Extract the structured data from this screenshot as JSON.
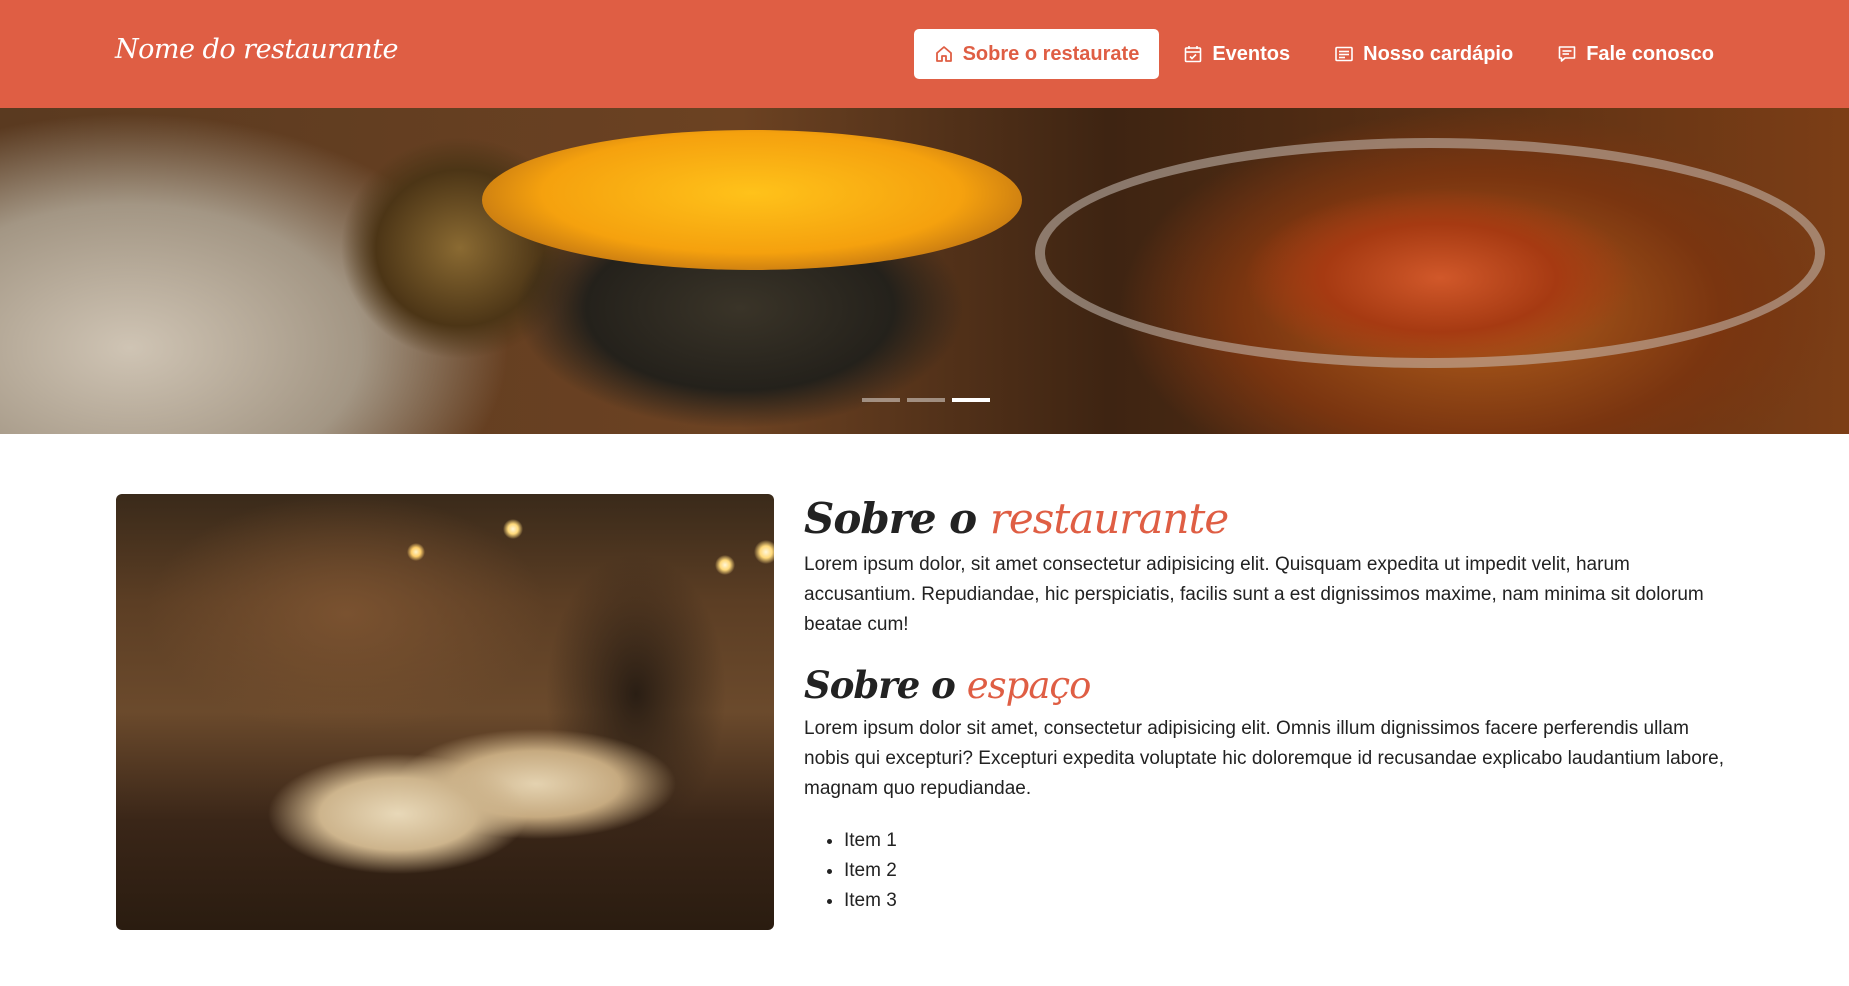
{
  "navbar": {
    "brand": "Nome do restaurante",
    "links": [
      {
        "label": "Sobre o restaurate",
        "icon": "home-icon",
        "active": true
      },
      {
        "label": "Eventos",
        "icon": "calendar-check-icon",
        "active": false
      },
      {
        "label": "Nosso cardápio",
        "icon": "menu-card-icon",
        "active": false
      },
      {
        "label": "Fale conosco",
        "icon": "chat-icon",
        "active": false
      }
    ]
  },
  "hero": {
    "slides_total": 3,
    "active_slide": 3
  },
  "about": {
    "title_prefix": "Sobre o",
    "title_accent": "restaurante",
    "text": "Lorem ipsum dolor, sit amet consectetur adipisicing elit. Quisquam expedita ut impedit velit, harum accusantium. Repudiandae, hic perspiciatis, facilis sunt a est dignissimos maxime, nam minima sit dolorum beatae cum!"
  },
  "space": {
    "title_prefix": "Sobre o",
    "title_accent": "espaço",
    "text": "Lorem ipsum dolor sit amet, consectetur adipisicing elit. Omnis illum dignissimos facere perferendis ullam nobis qui excepturi? Excepturi expedita voluptate hic doloremque id recusandae explicabo laudantium labore, magnam quo repudiandae.",
    "items": [
      "Item 1",
      "Item 2",
      "Item 3"
    ]
  },
  "colors": {
    "primary": "#df5e44",
    "text": "#222222",
    "background": "#ffffff"
  }
}
